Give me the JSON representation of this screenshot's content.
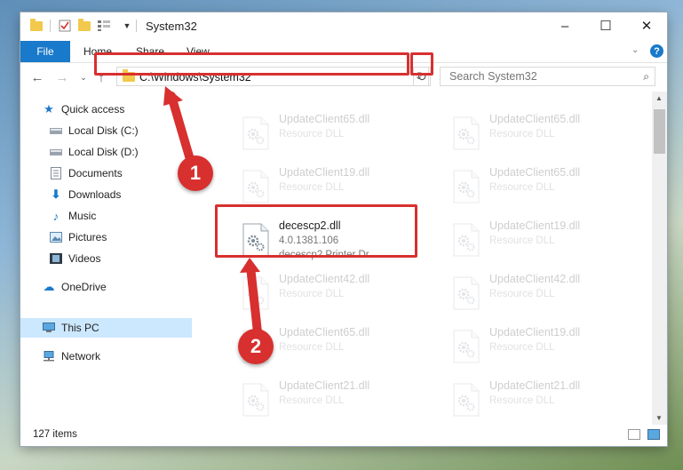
{
  "window": {
    "title": "System32",
    "controls": {
      "minimize": "–",
      "maximize": "☐",
      "close": "✕"
    }
  },
  "ribbon": {
    "tabs": [
      "File",
      "Home",
      "Share",
      "View"
    ]
  },
  "address": {
    "path": "C:\\Windows\\System32",
    "search_placeholder": "Search System32"
  },
  "nav": {
    "items": [
      {
        "label": "Quick access",
        "icon": "star-icon"
      },
      {
        "label": "Local Disk (C:)",
        "icon": "drive-icon"
      },
      {
        "label": "Local Disk (D:)",
        "icon": "drive-icon"
      },
      {
        "label": "Documents",
        "icon": "documents-icon"
      },
      {
        "label": "Downloads",
        "icon": "downloads-icon"
      },
      {
        "label": "Music",
        "icon": "music-icon"
      },
      {
        "label": "Pictures",
        "icon": "pictures-icon"
      },
      {
        "label": "Videos",
        "icon": "videos-icon"
      },
      {
        "label": "OneDrive",
        "icon": "cloud-icon"
      },
      {
        "label": "This PC",
        "icon": "computer-icon"
      },
      {
        "label": "Network",
        "icon": "network-icon"
      }
    ]
  },
  "files": [
    {
      "name": "UpdateClient65.dll",
      "sub": "Resource DLL",
      "faded": true
    },
    {
      "name": "UpdateClient65.dll",
      "sub": "Resource DLL",
      "faded": true
    },
    {
      "name": "UpdateClient19.dll",
      "sub": "Resource DLL",
      "faded": true
    },
    {
      "name": "UpdateClient65.dll",
      "sub": "Resource DLL",
      "faded": true
    },
    {
      "name": "decescp2.dll",
      "sub": "4.0.1381.106",
      "desc": "decescp2 Printer Dr...",
      "faded": false
    },
    {
      "name": "UpdateClient19.dll",
      "sub": "Resource DLL",
      "faded": true
    },
    {
      "name": "UpdateClient42.dll",
      "sub": "Resource DLL",
      "faded": true
    },
    {
      "name": "UpdateClient42.dll",
      "sub": "Resource DLL",
      "faded": true
    },
    {
      "name": "UpdateClient65.dll",
      "sub": "Resource DLL",
      "faded": true
    },
    {
      "name": "UpdateClient19.dll",
      "sub": "Resource DLL",
      "faded": true
    },
    {
      "name": "UpdateClient21.dll",
      "sub": "Resource DLL",
      "faded": true
    },
    {
      "name": "UpdateClient21.dll",
      "sub": "Resource DLL",
      "faded": true
    }
  ],
  "status": {
    "item_count": "127 items"
  },
  "annotations": {
    "step1": "1",
    "step2": "2"
  },
  "colors": {
    "accent": "#1979ca",
    "highlight": "#d7302f",
    "selected": "#cce8ff",
    "folder": "#f2c94c"
  }
}
